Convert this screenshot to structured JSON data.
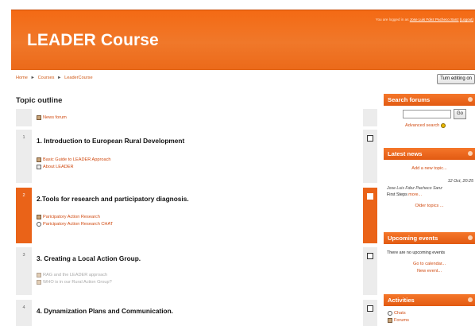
{
  "header": {
    "title": "LEADER Course",
    "login_prefix": "You are logged in as",
    "login_user": "Jose Luis Fdez Pacheco Sanz",
    "logout_label": "(Logout)"
  },
  "nav": {
    "breadcrumbs": [
      "Home",
      "Courses",
      "LeaderCourse"
    ],
    "separator": "►",
    "turn_editing_label": "Turn editing on"
  },
  "main": {
    "heading": "Topic outline",
    "sections": [
      {
        "number": "",
        "title": "",
        "activities": [
          {
            "icon": "forum-icon",
            "label": "News forum",
            "dimmed": false
          }
        ]
      },
      {
        "number": "1",
        "title": "1. Introduction to European Rural Development",
        "activities": [
          {
            "icon": "resource-icon",
            "label": "Basic Guide to LEADER Approach",
            "dimmed": false
          },
          {
            "icon": "page-icon",
            "label": "About LEADER",
            "dimmed": false
          }
        ]
      },
      {
        "number": "2",
        "title": "2.Tools for research and participatory diagnosis.",
        "current": true,
        "activities": [
          {
            "icon": "resource-icon",
            "label": "Paricipatory Action Research",
            "dimmed": false
          },
          {
            "icon": "chat-icon",
            "label": "Paricipatory Action Research CHAT",
            "dimmed": false
          }
        ]
      },
      {
        "number": "3",
        "title": "3. Creating a Local Action Group.",
        "activities": [
          {
            "icon": "resource-icon",
            "label": "RAG and the LEADER approach",
            "dimmed": true
          },
          {
            "icon": "resource-icon",
            "label": "WHO is in our Rural Action Group?",
            "dimmed": true
          }
        ]
      },
      {
        "number": "4",
        "title": "4. Dynamization Plans and Communication.",
        "activities": []
      }
    ]
  },
  "sidebar": {
    "search": {
      "title": "Search forums",
      "go_label": "Go",
      "advanced_label": "Advanced search"
    },
    "news": {
      "title": "Latest news",
      "add_label": "Add a new topic...",
      "date": "12 Oct, 20:25",
      "author": "Jose Luis Fdez Pacheco Sanz",
      "subject": "First Steps",
      "more_label": "more...",
      "older_label": "Older topics ..."
    },
    "events": {
      "title": "Upcoming events",
      "none_text": "There are no upcoming events",
      "calendar_label": "Go to calendar...",
      "new_event_label": "New event..."
    },
    "activities": {
      "title": "Activities",
      "items": [
        {
          "icon": "chat-icon",
          "label": "Chats"
        },
        {
          "icon": "forum-icon",
          "label": "Forums"
        }
      ]
    }
  },
  "colors": {
    "brand": "#f0782a",
    "link": "#d04a10",
    "current_section": "#ea6318"
  }
}
